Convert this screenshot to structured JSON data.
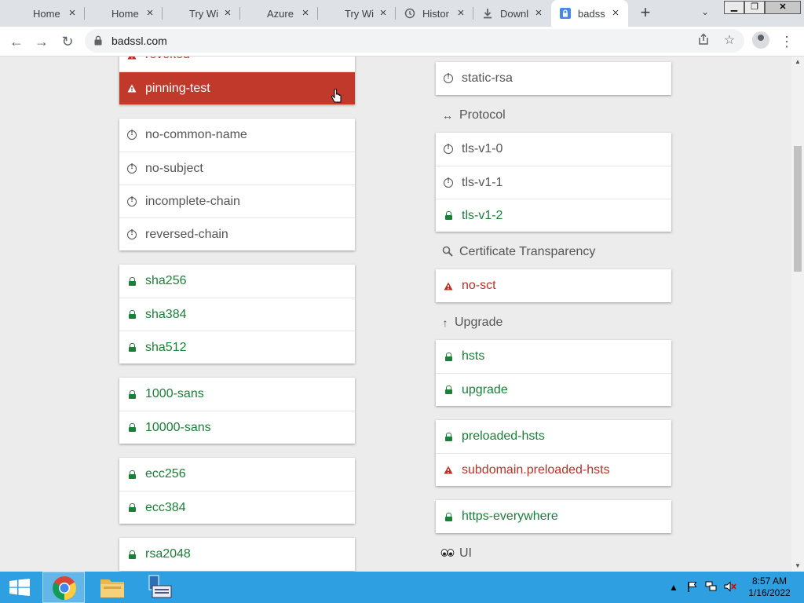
{
  "browser": {
    "tabs": [
      {
        "title": "Home",
        "icon": "microsoft-logo",
        "active": false
      },
      {
        "title": "Home",
        "icon": "microsoft-logo",
        "active": false
      },
      {
        "title": "Try Wi",
        "icon": "microsoft-logo",
        "active": false
      },
      {
        "title": "Azure",
        "icon": "microsoft-logo",
        "active": false
      },
      {
        "title": "Try Wi",
        "icon": "microsoft-logo",
        "active": false
      },
      {
        "title": "Histor",
        "icon": "history-icon",
        "active": false
      },
      {
        "title": "Downl",
        "icon": "download-icon",
        "active": false
      },
      {
        "title": "badss",
        "icon": "lock-icon",
        "active": true
      }
    ],
    "url": "badssl.com"
  },
  "left_column": [
    {
      "items": [
        {
          "label": "revoked",
          "status": "red"
        },
        {
          "label": "pinning-test",
          "status": "danger"
        }
      ]
    },
    {
      "items": [
        {
          "label": "no-common-name",
          "status": "neutral"
        },
        {
          "label": "no-subject",
          "status": "neutral"
        },
        {
          "label": "incomplete-chain",
          "status": "neutral"
        },
        {
          "label": "reversed-chain",
          "status": "neutral"
        }
      ]
    },
    {
      "items": [
        {
          "label": "sha256",
          "status": "green"
        },
        {
          "label": "sha384",
          "status": "green"
        },
        {
          "label": "sha512",
          "status": "green"
        }
      ]
    },
    {
      "items": [
        {
          "label": "1000-sans",
          "status": "green"
        },
        {
          "label": "10000-sans",
          "status": "green"
        }
      ]
    },
    {
      "items": [
        {
          "label": "ecc256",
          "status": "green"
        },
        {
          "label": "ecc384",
          "status": "green"
        }
      ]
    },
    {
      "items": [
        {
          "label": "rsa2048",
          "status": "green"
        }
      ]
    }
  ],
  "right_column": {
    "static_rsa": {
      "label": "static-rsa",
      "status": "neutral"
    },
    "sections": [
      {
        "title": "Protocol",
        "icon": "arrows-horizontal-icon",
        "items": [
          {
            "label": "tls-v1-0",
            "status": "neutral"
          },
          {
            "label": "tls-v1-1",
            "status": "neutral"
          },
          {
            "label": "tls-v1-2",
            "status": "green"
          }
        ]
      },
      {
        "title": "Certificate Transparency",
        "icon": "magnifier-icon",
        "items": [
          {
            "label": "no-sct",
            "status": "red"
          }
        ]
      },
      {
        "title": "Upgrade",
        "icon": "arrow-up-icon",
        "items": [
          {
            "label": "hsts",
            "status": "green"
          },
          {
            "label": "upgrade",
            "status": "green"
          }
        ]
      }
    ],
    "preload_items": [
      {
        "label": "preloaded-hsts",
        "status": "green"
      },
      {
        "label": "subdomain.preloaded-hsts",
        "status": "red"
      }
    ],
    "https_everywhere": {
      "label": "https-everywhere",
      "status": "green"
    },
    "ui_section": {
      "title": "UI",
      "icon": "eyes-icon"
    }
  },
  "colors": {
    "green": "#1a7f37",
    "red": "#b83226",
    "danger_bg": "#c0392b",
    "neutral": "#555555"
  },
  "taskbar": {
    "time": "8:57 AM",
    "date": "1/16/2022"
  }
}
